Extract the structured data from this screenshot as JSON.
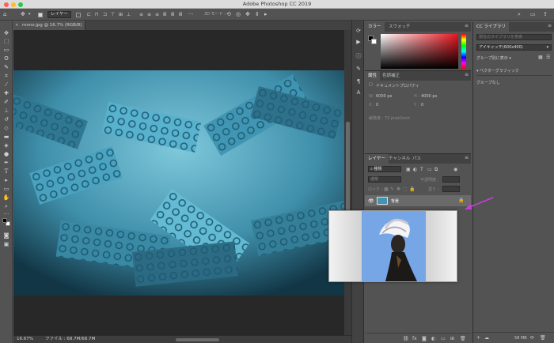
{
  "window": {
    "title": "Adobe Photoshop CC 2019",
    "traffic": {
      "close": "#ff5f57",
      "minimize": "#febc2e",
      "zoom": "#28c840"
    }
  },
  "options_bar": {
    "move_tool_icon": "move-icon",
    "auto_select_target": "レイヤー",
    "more_icon": "ellipsis-icon",
    "mode_3d_label": "3D モード :"
  },
  "document_tab": {
    "close_glyph": "×",
    "label": "mono.jpg @ 16.7% (RGB/8)"
  },
  "tools": [
    "move-icon",
    "artboard-icon",
    "marquee-icon",
    "lasso-icon",
    "quick-select-icon",
    "crop-icon",
    "eyedropper-icon",
    "healing-icon",
    "brush-icon",
    "stamp-icon",
    "history-brush-icon",
    "eraser-icon",
    "gradient-icon",
    "blur-icon",
    "dodge-icon",
    "pen-icon",
    "type-icon",
    "path-select-icon",
    "rectangle-icon",
    "hand-icon",
    "zoom-icon",
    "edit-toolbar-icon"
  ],
  "status": {
    "zoom": "16.67%",
    "file_info": "ファイル : 68.7M/68.7M"
  },
  "color_panel": {
    "tabs": [
      "カラー",
      "スウォッチ"
    ],
    "accent": "#e8141e"
  },
  "properties_panel": {
    "tabs": [
      "属性",
      "色調補正"
    ],
    "section": "ドキュメントプロパティ",
    "w_label": "W :",
    "w_value": "6000 px",
    "h_label": "H :",
    "h_value": "4000 px",
    "x_label": "X :",
    "x_value": "0",
    "y_label": "Y :",
    "y_value": "0",
    "resolution": "解像度 : 72 pixel/inch"
  },
  "layers_panel": {
    "tabs": [
      "レイヤー",
      "チャンネル",
      "パス"
    ],
    "kind_placeholder": "種類",
    "blend_mode": "通常",
    "opacity_label": "不透明度 :",
    "lock_label": "ロック :",
    "fill_label": "塗り :",
    "layer_name": "背景"
  },
  "library_panel": {
    "tab": "CC ライブラリ",
    "search_placeholder": "現在のライブラリを検索",
    "library_name": "アイキャッチ(600x400)",
    "group_view": "グループ別に表示",
    "section": "ベクターグラフィック",
    "group_none": "グループなし",
    "storage": "58 MB"
  },
  "annotation": {
    "arrow_color": "#c640d6"
  }
}
